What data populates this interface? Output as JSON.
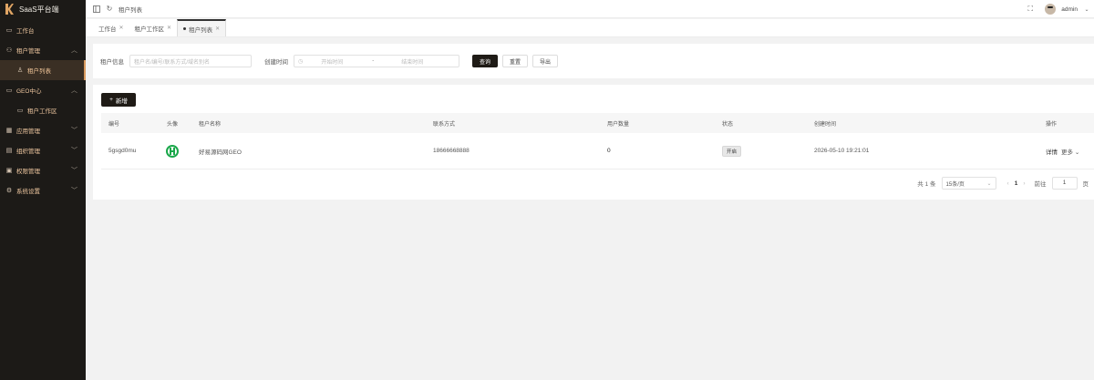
{
  "app": {
    "title": "SaaS平台端"
  },
  "sidebar": {
    "items": [
      {
        "label": "工作台",
        "icon": "monitor-icon"
      },
      {
        "label": "租户管理",
        "icon": "users-icon",
        "expanded": true
      },
      {
        "label": "租户列表",
        "icon": "user-icon",
        "sub": true,
        "active": true
      },
      {
        "label": "GEO中心",
        "icon": "geo-icon",
        "expanded": true
      },
      {
        "label": "租户工作区",
        "icon": "monitor-icon",
        "sub": true
      },
      {
        "label": "应用管理",
        "icon": "grid-icon"
      },
      {
        "label": "组织管理",
        "icon": "org-icon"
      },
      {
        "label": "权限管理",
        "icon": "lock-icon"
      },
      {
        "label": "系统设置",
        "icon": "gear-icon"
      }
    ]
  },
  "topbar": {
    "breadcrumb": "租户列表",
    "user": "admin"
  },
  "tabs": [
    {
      "label": "工作台",
      "active": false
    },
    {
      "label": "租户工作区",
      "active": false
    },
    {
      "label": "租户列表",
      "active": true
    }
  ],
  "filter": {
    "tenant_label": "租户信息",
    "tenant_placeholder": "租户名/编号/联系方式/域名别名",
    "created_label": "创建时间",
    "start_placeholder": "开始时间",
    "range_sep": "-",
    "end_placeholder": "结束时间",
    "query": "查询",
    "reset": "重置",
    "export": "导出"
  },
  "table": {
    "add_label": "新增",
    "columns": [
      "编号",
      "头像",
      "租户名称",
      "联系方式",
      "用户数量",
      "状态",
      "创建时间",
      "操作"
    ],
    "rows": [
      {
        "id": "5gsgd0mu",
        "name": "好易源码网GEO",
        "contact": "18666668888",
        "users": "0",
        "status": "开启",
        "created": "2026-05-10 19:21:01",
        "detail": "详情",
        "more": "更多"
      }
    ]
  },
  "pagination": {
    "total": "共 1 条",
    "page_size": "15条/页",
    "current": "1",
    "goto_label": "前往",
    "goto_value": "1",
    "page_suffix": "页"
  },
  "colors": {
    "sidebar_bg": "#1c1a17",
    "accent": "#d89a5e",
    "button_dark": "#1f1b16",
    "logo_green": "#1aa74a"
  }
}
